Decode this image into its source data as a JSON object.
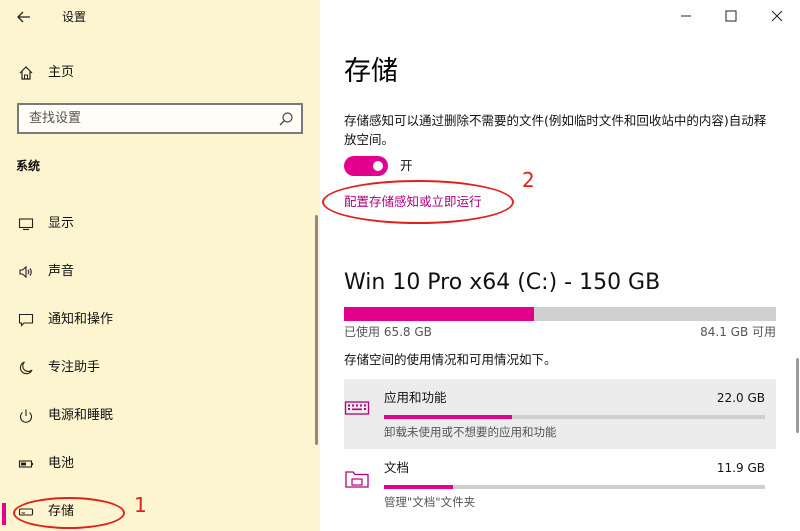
{
  "window": {
    "title": "设置",
    "back_icon": "arrow-left-icon",
    "controls": [
      "minimize-icon",
      "maximize-icon",
      "close-icon"
    ]
  },
  "sidebar": {
    "home": {
      "label": "主页",
      "icon": "home-icon"
    },
    "search": {
      "placeholder": "查找设置",
      "icon": "search-icon"
    },
    "section": "系统",
    "items": [
      {
        "label": "显示",
        "icon": "monitor-icon"
      },
      {
        "label": "声音",
        "icon": "speaker-icon"
      },
      {
        "label": "通知和操作",
        "icon": "notification-icon"
      },
      {
        "label": "专注助手",
        "icon": "moon-icon"
      },
      {
        "label": "电源和睡眠",
        "icon": "power-icon"
      },
      {
        "label": "电池",
        "icon": "battery-icon"
      },
      {
        "label": "存储",
        "icon": "storage-icon",
        "selected": true
      }
    ]
  },
  "annotations": {
    "marker1": "1",
    "marker2": "2"
  },
  "main": {
    "title": "存储",
    "description": "存储感知可以通过删除不需要的文件(例如临时文件和回收站中的内容)自动释放空间。",
    "toggle": {
      "state": "on",
      "label": "开"
    },
    "config_link": "配置存储感知或立即运行",
    "drive": {
      "title": "Win 10 Pro x64 (C:) - 150 GB",
      "used_label": "已使用 65.8 GB",
      "free_label": "84.1 GB 可用",
      "used_fraction": 0.439
    },
    "usage_description": "存储空间的使用情况和可用情况如下。",
    "categories": [
      {
        "name": "应用和功能",
        "size": "22.0 GB",
        "subtitle": "卸载未使用或不想要的应用和功能",
        "icon": "keyboard-icon",
        "fraction": 0.335
      },
      {
        "name": "文档",
        "size": "11.9 GB",
        "subtitle": "管理\"文档\"文件夹",
        "icon": "folder-icon",
        "fraction": 0.18
      }
    ]
  },
  "colors": {
    "accent": "#e3008c",
    "link": "#b1007b",
    "sidebar_bg": "#fdf5cf",
    "annotation": "#e0211b"
  }
}
